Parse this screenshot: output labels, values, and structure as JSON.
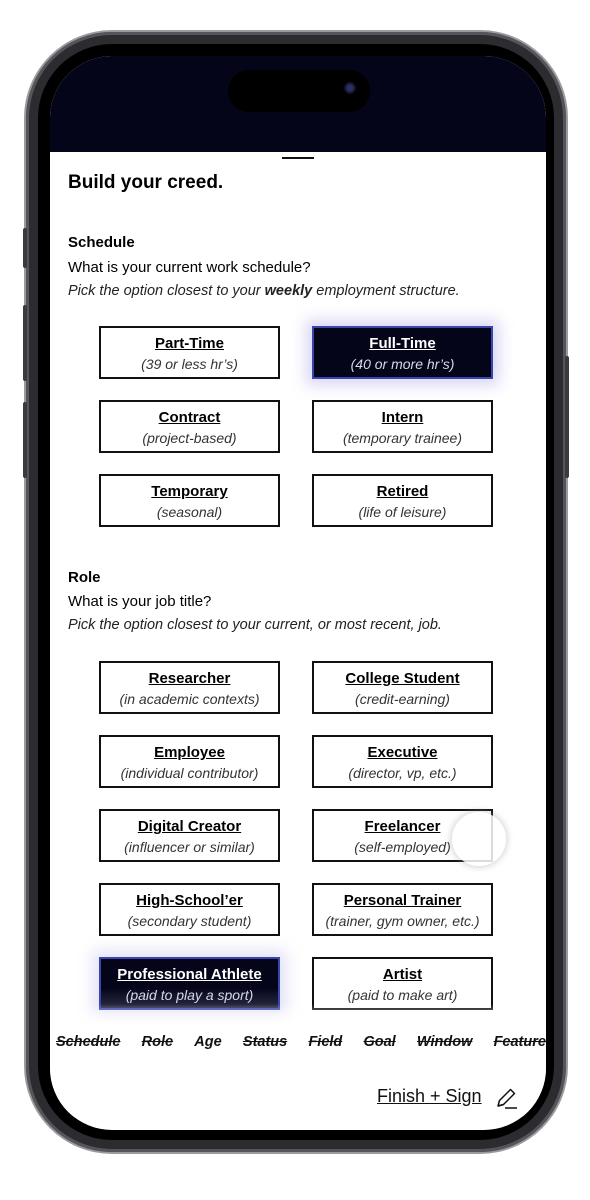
{
  "page_title": "Build your creed.",
  "schedule": {
    "heading": "Schedule",
    "question": "What is your current work schedule?",
    "hint_before": "Pick the option closest to your ",
    "hint_bold": "weekly",
    "hint_after": " employment structure.",
    "options": [
      {
        "title": "Part-Time",
        "subtitle": "(39 or less hr’s)"
      },
      {
        "title": "Full-Time",
        "subtitle": "(40 or more hr’s)",
        "selected": true
      },
      {
        "title": "Contract",
        "subtitle": "(project-based)"
      },
      {
        "title": "Intern",
        "subtitle": "(temporary trainee)"
      },
      {
        "title": "Temporary",
        "subtitle": "(seasonal)"
      },
      {
        "title": "Retired",
        "subtitle": "(life of leisure)"
      }
    ]
  },
  "role": {
    "heading": "Role",
    "question": "What is your job title?",
    "hint": "Pick the option closest to your current, or most recent, job.",
    "options": [
      {
        "title": "Researcher",
        "subtitle": "(in academic contexts)"
      },
      {
        "title": "College Student",
        "subtitle": "(credit-earning)"
      },
      {
        "title": "Employee",
        "subtitle": "(individual contributor)"
      },
      {
        "title": "Executive",
        "subtitle": "(director, vp, etc.)"
      },
      {
        "title": "Digital Creator",
        "subtitle": "(influencer or similar)"
      },
      {
        "title": "Freelancer",
        "subtitle": "(self-employed)"
      },
      {
        "title": "High-School’er",
        "subtitle": "(secondary student)"
      },
      {
        "title": "Personal Trainer",
        "subtitle": "(trainer, gym owner, etc.)"
      },
      {
        "title": "Professional Athlete",
        "subtitle": "(paid to play a sport)",
        "selected": true
      },
      {
        "title": "Artist",
        "subtitle": "(paid to make art)"
      }
    ]
  },
  "steps": [
    "Schedule",
    "Role",
    "Age",
    "Status",
    "Field",
    "Goal",
    "Window",
    "Feature"
  ],
  "current_step": "Age",
  "finish_label": "Finish + Sign",
  "icons": {
    "finish": "pencil-icon"
  },
  "colors": {
    "selected_bg": "#05051a",
    "selected_border": "#3a46b0"
  }
}
